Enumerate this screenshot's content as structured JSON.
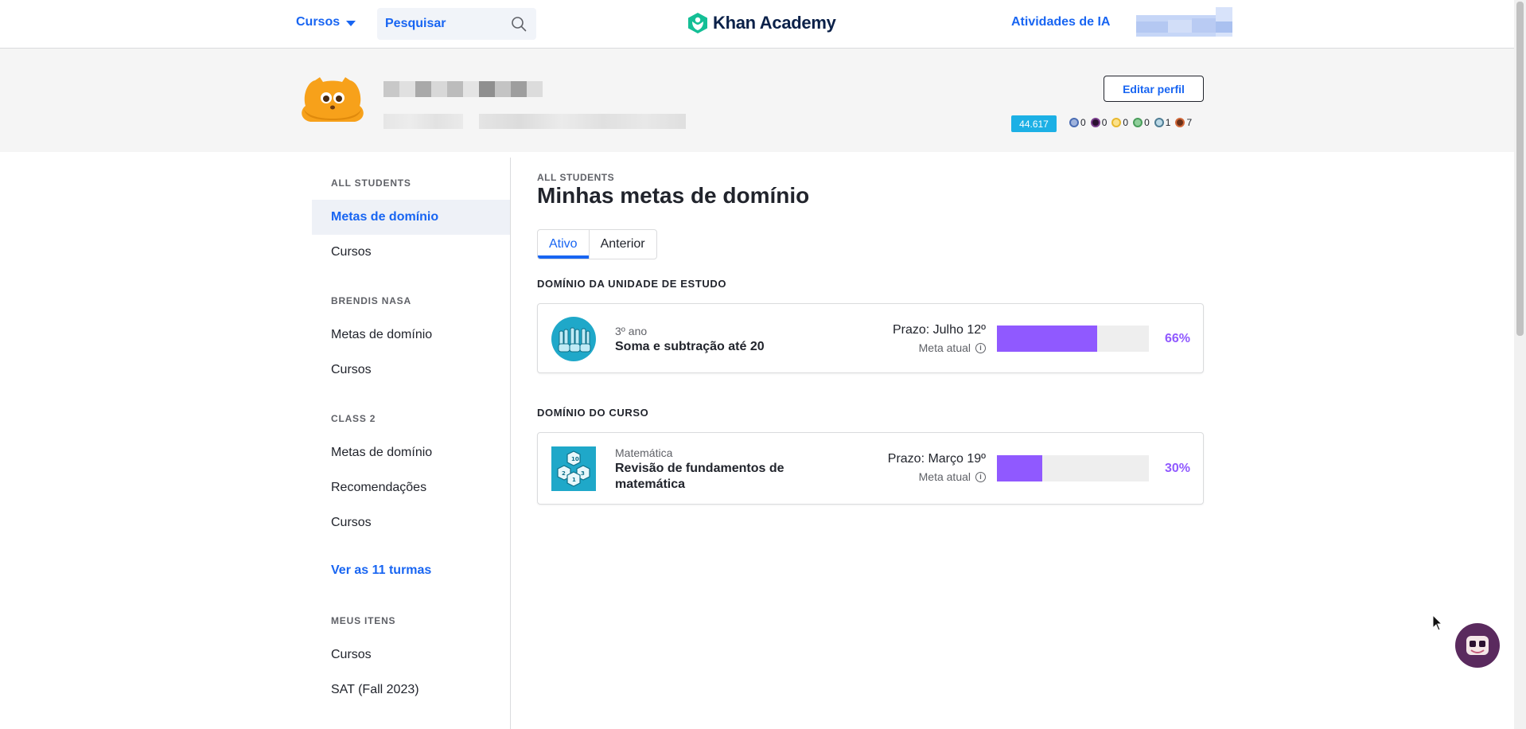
{
  "header": {
    "courses_label": "Cursos",
    "search_placeholder": "Pesquisar",
    "logo_text": "Khan Academy",
    "ai_activities": "Atividades de IA"
  },
  "profile": {
    "edit_button": "Editar perfil",
    "points": "44.617",
    "badges": [
      {
        "icon": "challenge-patch-badge-icon",
        "count": "0",
        "color": "#4a6cb3"
      },
      {
        "icon": "black-hole-badge-icon",
        "count": "0",
        "color": "#7a3d8c"
      },
      {
        "icon": "sun-badge-icon",
        "count": "0",
        "color": "#e8b82e"
      },
      {
        "icon": "earth-badge-icon",
        "count": "0",
        "color": "#4a9d5b"
      },
      {
        "icon": "moon-badge-icon",
        "count": "1",
        "color": "#7ba7bd"
      },
      {
        "icon": "meteorite-badge-icon",
        "count": "7",
        "color": "#d2693a"
      }
    ]
  },
  "sidebar": {
    "sections": [
      {
        "label": "ALL STUDENTS",
        "items": [
          "Metas de domínio",
          "Cursos"
        ]
      },
      {
        "label": "BRENDIS NASA",
        "items": [
          "Metas de domínio",
          "Cursos"
        ]
      },
      {
        "label": "CLASS 2",
        "items": [
          "Metas de domínio",
          "Recomendações",
          "Cursos"
        ]
      },
      {
        "label": "MEUS ITENS",
        "items": [
          "Cursos",
          "SAT (Fall 2023)"
        ]
      }
    ],
    "see_all_link": "Ver as 11 turmas"
  },
  "main": {
    "eyebrow": "ALL STUDENTS",
    "title": "Minhas metas de domínio",
    "tabs": [
      "Ativo",
      "Anterior"
    ],
    "unit_heading": "DOMÍNIO DA UNIDADE DE ESTUDO",
    "course_heading": "DOMÍNIO DO CURSO",
    "goals": [
      {
        "subject": "3º ano",
        "title": "Soma e subtração até 20",
        "due": "Prazo: Julho 12º",
        "goal_label": "Meta atual",
        "progress": 0.66,
        "percent": "66%"
      },
      {
        "subject": "Matemática",
        "title": "Revisão de fundamentos de matemática",
        "due": "Prazo: Março 19º",
        "goal_label": "Meta atual",
        "progress": 0.3,
        "percent": "30%"
      }
    ]
  },
  "colors": {
    "accent_blue": "#1865f2",
    "progress_purple": "#9059ff",
    "points_badge": "#1cb0e5"
  }
}
